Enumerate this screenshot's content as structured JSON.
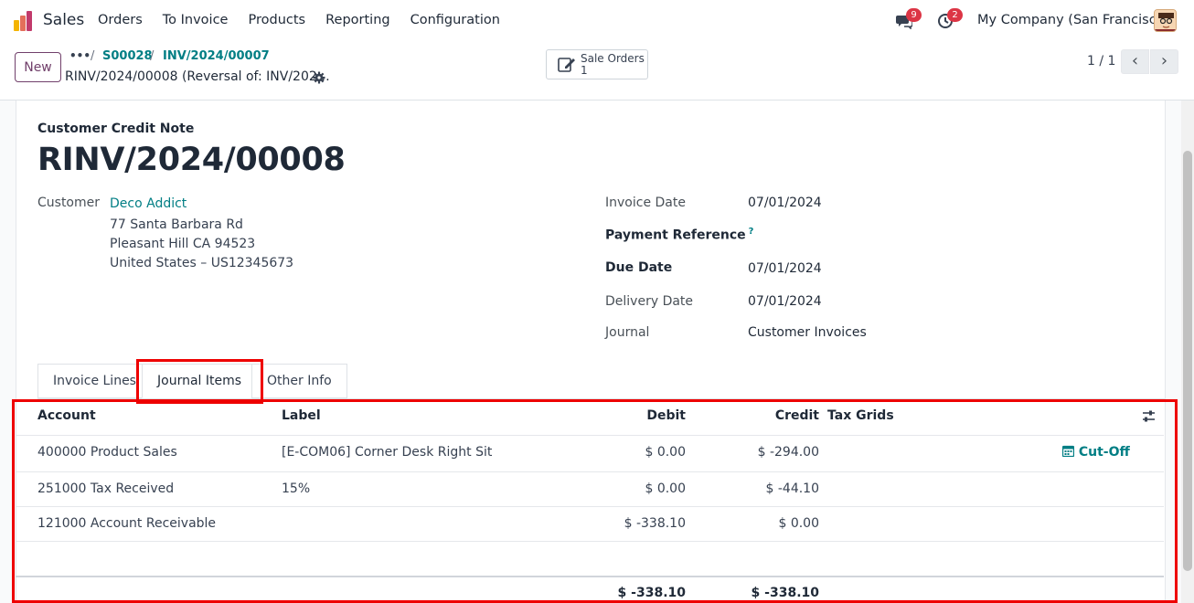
{
  "topnav": {
    "app_name": "Sales",
    "menu": [
      "Orders",
      "To Invoice",
      "Products",
      "Reporting",
      "Configuration"
    ],
    "messages_count": "9",
    "activities_count": "2",
    "company": "My Company (San Francisco)"
  },
  "control": {
    "new_label": "New",
    "breadcrumb_dots": "•••",
    "breadcrumb_sep": "/",
    "breadcrumb_1": "S00028",
    "breadcrumb_2": "INV/2024/00007",
    "current": "RINV/2024/00008 (Reversal of: INV/202…",
    "smart_button_label": "Sale Orders",
    "smart_button_count": "1",
    "pager": "1 / 1"
  },
  "document": {
    "type": "Customer Credit Note",
    "number": "RINV/2024/00008",
    "customer_label": "Customer",
    "customer_name": "Deco Addict",
    "address_1": "77 Santa Barbara Rd",
    "address_2": "Pleasant Hill CA 94523",
    "address_3": "United States – US12345673",
    "invoice_date_label": "Invoice Date",
    "invoice_date": "07/01/2024",
    "payment_ref_label": "Payment Reference",
    "payment_ref_help": "?",
    "due_date_label": "Due Date",
    "due_date": "07/01/2024",
    "delivery_date_label": "Delivery Date",
    "delivery_date": "07/01/2024",
    "journal_label": "Journal",
    "journal": "Customer Invoices"
  },
  "tabs": [
    "Invoice Lines",
    "Journal Items",
    "Other Info"
  ],
  "table": {
    "headers": {
      "account": "Account",
      "label": "Label",
      "debit": "Debit",
      "credit": "Credit",
      "tax_grids": "Tax Grids"
    },
    "rows": [
      {
        "account": "400000 Product Sales",
        "label": "[E-COM06] Corner Desk Right Sit",
        "debit": "$ 0.00",
        "credit": "$ -294.00",
        "cutoff": "Cut-Off"
      },
      {
        "account": "251000 Tax Received",
        "label": "15%",
        "debit": "$ 0.00",
        "credit": "$ -44.10"
      },
      {
        "account": "121000 Account Receivable",
        "label": "",
        "debit": "$ -338.10",
        "credit": "$ 0.00"
      }
    ],
    "totals": {
      "debit": "$ -338.10",
      "credit": "$ -338.10"
    }
  },
  "colors": {
    "accent": "#017e84",
    "brand": "#71406b",
    "highlight": "#ee0000"
  }
}
